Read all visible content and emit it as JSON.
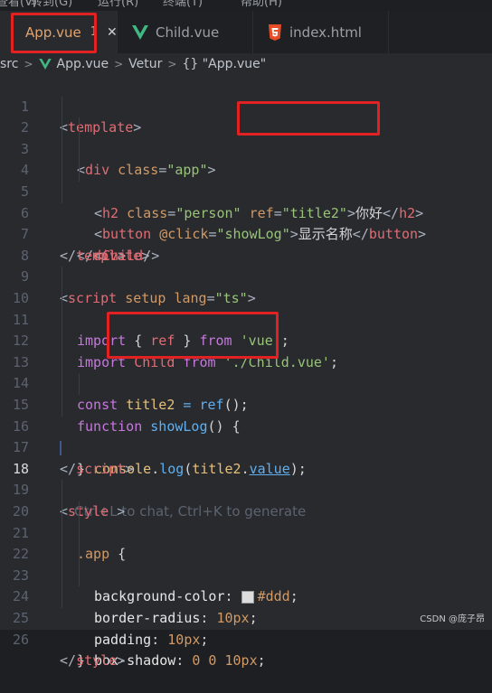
{
  "menubar": {
    "items": [
      "查看(V)",
      "转到(G)",
      "运行(R)",
      "终端(T)",
      "帮助(H)"
    ]
  },
  "tabs": [
    {
      "label": "App.vue",
      "badge": "1",
      "close": "✕",
      "icon": "vue-icon",
      "active": true
    },
    {
      "label": "Child.vue",
      "icon": "vue-icon",
      "active": false
    },
    {
      "label": "index.html",
      "icon": "html5-icon",
      "active": false
    }
  ],
  "breadcrumb": {
    "parts": [
      "src",
      "App.vue",
      "Vetur",
      "{} \"App.vue\""
    ]
  },
  "editor": {
    "current_line": 18,
    "ghost_hint": "Ctrl+L to chat, Ctrl+K to generate",
    "line_numbers": [
      "1",
      "2",
      "3",
      "4",
      "5",
      "6",
      "7",
      "8",
      "9",
      "10",
      "11",
      "12",
      "13",
      "14",
      "15",
      "16",
      "17",
      "18",
      "19",
      "20",
      "21",
      "22",
      "23",
      "24",
      "25",
      "26"
    ]
  },
  "code": {
    "l1": [
      "<",
      "template",
      ">"
    ],
    "l2": [
      "<",
      "div",
      " ",
      "class",
      "=",
      "\"app\"",
      ">"
    ],
    "l3": [
      "<",
      "h2",
      " ",
      "class",
      "=",
      "\"person\"",
      " ",
      "ref",
      "=",
      "\"title2\"",
      ">",
      "你好",
      "</",
      "h2",
      ">"
    ],
    "l4": [
      "<",
      "button",
      " ",
      "@click",
      "=",
      "\"showLog\"",
      ">",
      "显示名称",
      "</",
      "button",
      ">"
    ],
    "l5": [
      "<",
      "Child",
      "/>"
    ],
    "l6": [
      "</",
      "div",
      ">"
    ],
    "l7": [
      "</",
      "template",
      ">"
    ],
    "l9": [
      "<",
      "script",
      " ",
      "setup",
      " ",
      "lang",
      "=",
      "\"ts\"",
      ">"
    ],
    "l10": [
      "import",
      " { ",
      "ref",
      " } ",
      "from",
      " ",
      "'vue'",
      ";"
    ],
    "l11": [
      "import",
      " ",
      "Child",
      " ",
      "from",
      " ",
      "'./Child.vue'",
      ";"
    ],
    "l13": [
      "const",
      " ",
      "title2",
      " = ",
      "ref",
      "();"
    ],
    "l14": [
      "function",
      " ",
      "showLog",
      "() {"
    ],
    "l15": [
      "console",
      ".",
      "log",
      "(",
      "title2",
      ".",
      "value",
      ");"
    ],
    "l16": [
      "}"
    ],
    "l17": [
      "</",
      "script",
      ">"
    ],
    "l19": [
      "<",
      "style",
      " >"
    ],
    "l20": [
      ".app",
      " {"
    ],
    "l21": [
      "background-color",
      ": ",
      "#ddd",
      ";"
    ],
    "l22": [
      "border-radius",
      ": ",
      "10px",
      ";"
    ],
    "l23": [
      "padding",
      ": ",
      "10px",
      ";"
    ],
    "l24": [
      "box-shadow",
      ": ",
      "0 0 10px",
      ";"
    ],
    "l25": [
      "}"
    ],
    "l26": [
      "</",
      "style",
      ">"
    ]
  },
  "colors": {
    "highlight_box": "#e22222",
    "swatch": "#dddddd",
    "tab_active_text": "#e2a36f"
  },
  "watermark": "CSDN @庞子昂"
}
